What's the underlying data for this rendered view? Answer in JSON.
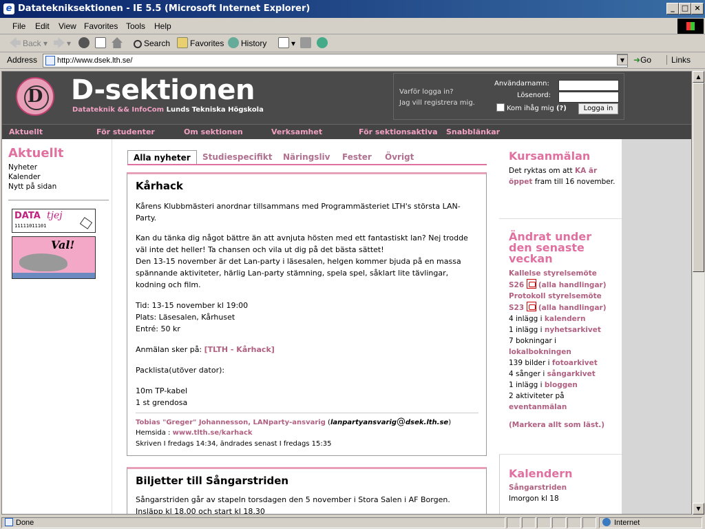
{
  "window": {
    "title": "Datatekniksektionen - IE 5.5 (Microsoft Internet Explorer)",
    "buttons": {
      "minimize": "_",
      "maximize": "□",
      "close": "×"
    }
  },
  "menu": [
    "File",
    "Edit",
    "View",
    "Favorites",
    "Tools",
    "Help"
  ],
  "toolbar": {
    "back": "Back",
    "search": "Search",
    "favorites": "Favorites",
    "history": "History"
  },
  "address": {
    "label": "Address",
    "url": "http://www.dsek.lth.se/",
    "go": "Go",
    "links": "Links"
  },
  "status": {
    "text": "Done",
    "zone": "Internet"
  },
  "site": {
    "title": "D-sektionen",
    "subtitle_left": "Datateknik && InfoCom",
    "subtitle_right": "Lunds Tekniska Högskola",
    "logo_letter": "D",
    "login": {
      "why": "Varför logga in?",
      "register": "Jag vill registrera mig.",
      "username_label": "Användarnamn:",
      "password_label": "Lösenord:",
      "remember": "Kom ihåg mig",
      "help": "(?)",
      "button": "Logga in"
    },
    "nav": [
      "Aktuellt",
      "För studenter",
      "Om sektionen",
      "Verksamhet",
      "För sektionsaktiva",
      "Snabblänkar"
    ]
  },
  "left": {
    "heading": "Aktuellt",
    "links": [
      "Nyheter",
      "Kalender",
      "Nytt på sidan"
    ],
    "banner1_a": "DATA",
    "banner1_b": "tjej",
    "banner1_bits": "11111011101",
    "banner2": "Val!"
  },
  "tabs": [
    "Alla nyheter",
    "Studiespecifikt",
    "Näringsliv",
    "Fester",
    "Övrigt"
  ],
  "article1": {
    "title": "Kårhack",
    "p1": "Kårens Klubbmästeri anordnar tillsammans med Programmästeriet LTH's största LAN-Party.",
    "p2": "Kan du tänka dig något bättre än att avnjuta hösten med ett fantastiskt lan? Nej trodde väl inte det heller! Ta chansen och vila ut dig på det bästa sättet!",
    "p3": "Den 13-15 november är det Lan-party i läsesalen, helgen kommer bjuda på en massa spännande aktiviteter, härlig Lan-party stämning, spela spel, såklart lite tävlingar, kodning och film.",
    "tid": "Tid: 13-15 november kl 19:00",
    "plats": "Plats: Läsesalen, Kårhuset",
    "entre": "Entré: 50 kr",
    "anmalan": "Anmälan sker på:",
    "anmalan_link": "[TLTH - Kårhack]",
    "packlista": "Packlista(utöver dator):",
    "item1": "10m TP-kabel",
    "item2": "1 st grendosa",
    "author": "Tobias \"Greger\" Johannesson, LANparty-ansvarig",
    "email_a": "lanpartyansvarig",
    "email_at": "@",
    "email_b": "dsek.lth.se",
    "hemsida_label": "Hemsida :",
    "hemsida": "www.tlth.se/karhack",
    "written": "Skriven I fredags 14:34, ändrades senast I fredags 15:35"
  },
  "article2": {
    "title": "Biljetter till Sångarstriden",
    "p1": "Sångarstriden går av stapeln torsdagen den 5 november i Stora Salen i AF Borgen.",
    "p2": "Insläpp kl 18.00 och start kl 18.30"
  },
  "right": {
    "kurs_heading": "Kursanmälan",
    "kurs_text_a": "Det ryktas om att",
    "kurs_link": "KA är öppet",
    "kurs_text_b": "fram till 16 november.",
    "andrat_heading": "Ändrat under den senaste veckan",
    "kallelse": "Kallelse styrelsemöte",
    "s26": "S26",
    "alla1": "(alla handlingar)",
    "protokoll": "Protokoll styrelsemöte",
    "s23": "S23",
    "alla2": "(alla handlingar)",
    "l1a": "4 inlägg i",
    "l1b": "kalendern",
    "l2a": "1 inlägg i",
    "l2b": "nyhetsarkivet",
    "l3a": "7 bokningar i",
    "l3b": "lokalbokningen",
    "l4a": "139 bilder i",
    "l4b": "fotoarkivet",
    "l5a": "4 sånger i",
    "l5b": "sångarkivet",
    "l6a": "1 inlägg i",
    "l6b": "bloggen",
    "l7a": "2 aktiviteter på",
    "l7b": "eventanmälan",
    "markera": "(Markera allt som läst.)",
    "kal_heading": "Kalendern",
    "kal_event": "Sångarstriden",
    "kal_time": "Imorgon kl 18"
  }
}
